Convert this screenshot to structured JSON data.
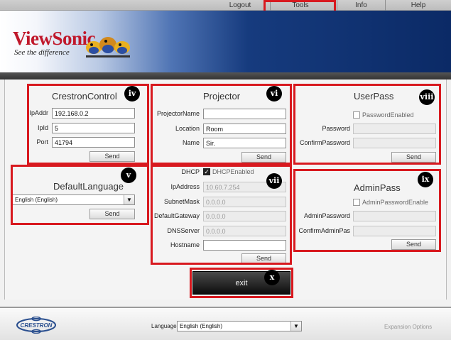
{
  "nav": {
    "logout": "Logout",
    "tools": "Tools",
    "info": "Info",
    "help": "Help"
  },
  "brand": {
    "logo": "ViewSonic",
    "tagline": "See the difference"
  },
  "crestron_control": {
    "title": "CrestronControl",
    "ipaddr_label": "IpAddr",
    "ipaddr": "192.168.0.2",
    "ipid_label": "IpId",
    "ipid": "5",
    "port_label": "Port",
    "port": "41794",
    "send": "Send"
  },
  "projector": {
    "title": "Projector",
    "projector_name_label": "ProjectorName",
    "projector_name": "",
    "location_label": "Location",
    "location": "Room",
    "name_label": "Name",
    "name": "Sir.",
    "send": "Send"
  },
  "user_pass": {
    "title": "UserPass",
    "password_enabled": "PasswordEnabled",
    "password_label": "Password",
    "confirm_label": "ConfirmPassword",
    "send": "Send"
  },
  "default_language": {
    "title": "DefaultLanguage",
    "selected": "English (English)",
    "send": "Send"
  },
  "network": {
    "dhcp_label": "DHCP",
    "dhcp_enabled": "DHCPEnabled",
    "ipaddress_label": "IpAddress",
    "ipaddress": "10.60.7.254",
    "subnet_label": "SubnetMask",
    "subnet": "0.0.0.0",
    "gateway_label": "DefaultGateway",
    "gateway": "0.0.0.0",
    "dns_label": "DNSServer",
    "dns": "0.0.0.0",
    "hostname_label": "Hostname",
    "hostname": "",
    "send": "Send"
  },
  "admin_pass": {
    "title": "AdminPass",
    "enable_label": "AdminPasswordEnable",
    "password_label": "AdminPassword",
    "confirm_label": "ConfirmAdminPas",
    "send": "Send"
  },
  "exit": "exit",
  "badges": {
    "iv": "iv",
    "v": "v",
    "vi": "vi",
    "vii": "vii",
    "viii": "viii",
    "ix": "ix",
    "x": "x"
  },
  "footer": {
    "crestron": "CRESTRON",
    "language_label": "Language",
    "language": "English (English)",
    "expansion": "Expansion Options"
  },
  "colors": {
    "callout_red": "#d8191f",
    "brand_red": "#c0182b",
    "header_blue": "#163b7e"
  }
}
